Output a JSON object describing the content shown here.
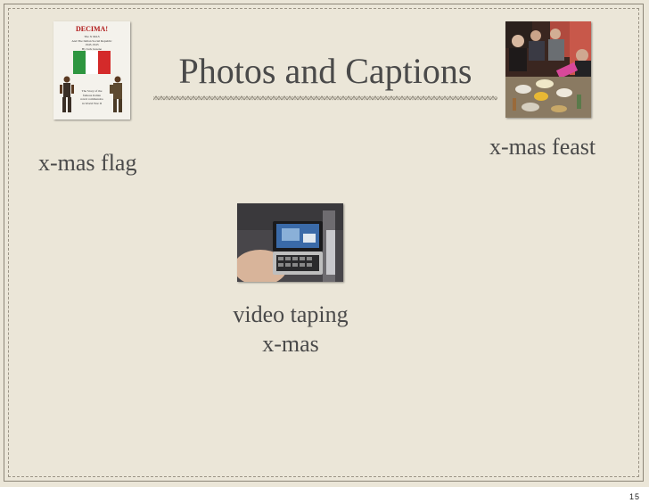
{
  "slide": {
    "title": "Photos and Captions",
    "page_number": "15"
  },
  "photos": [
    {
      "caption": "x-mas flag",
      "book": {
        "title": "DECIMA!",
        "subtitle_lines": [
          "The X MAS",
          "And The Italian Social Republic",
          "1943-1945",
          "By Jack Greene"
        ],
        "blurb_lines": [
          "The Story of the",
          "famous Italian",
          "naval commandos",
          "in World War II"
        ]
      }
    },
    {
      "caption": "x-mas feast"
    },
    {
      "caption_lines": [
        "video taping",
        "x-mas"
      ]
    }
  ],
  "colors": {
    "background": "#ebe6d8",
    "text": "#4a4a4a",
    "flag_green": "#2e9640",
    "flag_red": "#d42a2a"
  }
}
